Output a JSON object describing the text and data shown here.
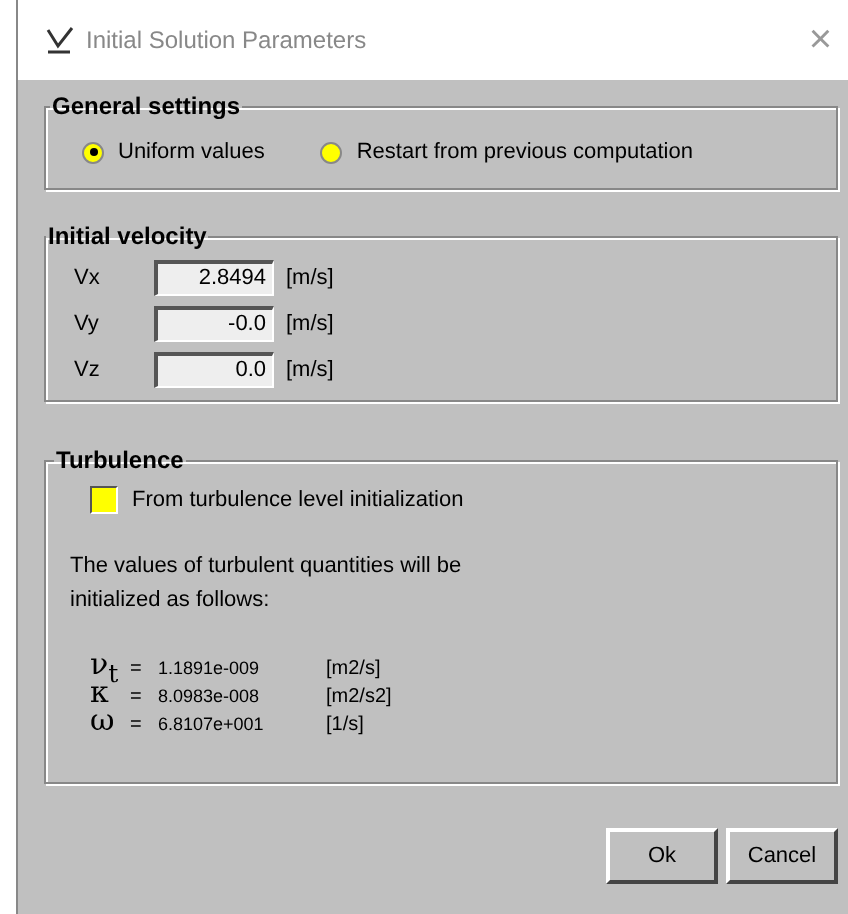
{
  "window": {
    "title": "Initial Solution Parameters",
    "close": "×"
  },
  "general_settings": {
    "title": "General settings",
    "options": [
      {
        "label": "Uniform values",
        "selected": true
      },
      {
        "label": "Restart from previous computation",
        "selected": false
      }
    ]
  },
  "initial_velocity": {
    "title": "Initial velocity",
    "fields": [
      {
        "label": "Vx",
        "value": "2.8494",
        "unit": "[m/s]"
      },
      {
        "label": "Vy",
        "value": "-0.0",
        "unit": "[m/s]"
      },
      {
        "label": "Vz",
        "value": "0.0",
        "unit": "[m/s]"
      }
    ]
  },
  "turbulence": {
    "title": "Turbulence",
    "checkbox": {
      "label": "From turbulence level initialization",
      "checked": false
    },
    "description": "The values of turbulent quantities will be initialized as follows:",
    "quantities": [
      {
        "symbol": "ν$_{t}$",
        "equals": "=",
        "value": "1.1891e-009",
        "unit": "[m2/s]"
      },
      {
        "symbol": "κ",
        "equals": "=",
        "value": "8.0983e-008",
        "unit": "[m2/s2]"
      },
      {
        "symbol": "ω",
        "equals": "=",
        "value": "6.8107e+001",
        "unit": "[1/s]"
      }
    ]
  },
  "buttons": [
    "Ok",
    "Cancel"
  ]
}
